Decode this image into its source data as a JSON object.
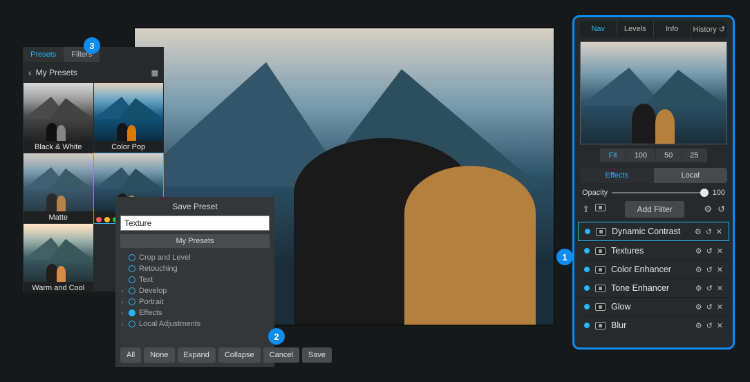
{
  "right": {
    "tabs": [
      "Nav",
      "Levels",
      "Info",
      "History"
    ],
    "active_tab": "Nav",
    "zoom": {
      "options": [
        "Fit",
        "100",
        "50",
        "25"
      ],
      "active": "Fit"
    },
    "filter_tabs": {
      "left": "Effects",
      "right": "Local",
      "active": "Effects"
    },
    "opacity": {
      "label": "Opacity",
      "value": "100"
    },
    "add_button": "Add Filter",
    "filters": [
      {
        "name": "Dynamic Contrast",
        "selected": true
      },
      {
        "name": "Textures"
      },
      {
        "name": "Color Enhancer"
      },
      {
        "name": "Tone Enhancer"
      },
      {
        "name": "Glow"
      },
      {
        "name": "Blur"
      }
    ]
  },
  "left": {
    "tabs": [
      "Presets",
      "Filters"
    ],
    "active_tab": "Presets",
    "back_title": "My Presets",
    "presets": [
      {
        "label": "Black & White",
        "kind": "bw"
      },
      {
        "label": "Color Pop",
        "kind": "pop"
      },
      {
        "label": "Matte",
        "kind": "matte"
      },
      {
        "label": "",
        "kind": "sel"
      },
      {
        "label": "Warm and Cool",
        "kind": "warm"
      }
    ]
  },
  "dialog": {
    "title": "Save Preset",
    "input_value": "Texture",
    "group_button": "My Presets",
    "tree": [
      {
        "label": "Crop and Level",
        "parent": false
      },
      {
        "label": "Retouching",
        "parent": false
      },
      {
        "label": "Text",
        "parent": false
      },
      {
        "label": "Develop",
        "parent": true
      },
      {
        "label": "Portrait",
        "parent": true
      },
      {
        "label": "Effects",
        "parent": true,
        "checked": true
      },
      {
        "label": "Local Adjustments",
        "parent": true
      }
    ],
    "buttons": [
      "All",
      "None",
      "Expand",
      "Collapse",
      "Cancel",
      "Save"
    ]
  },
  "badges": {
    "b1": "1",
    "b2": "2",
    "b3": "3"
  }
}
